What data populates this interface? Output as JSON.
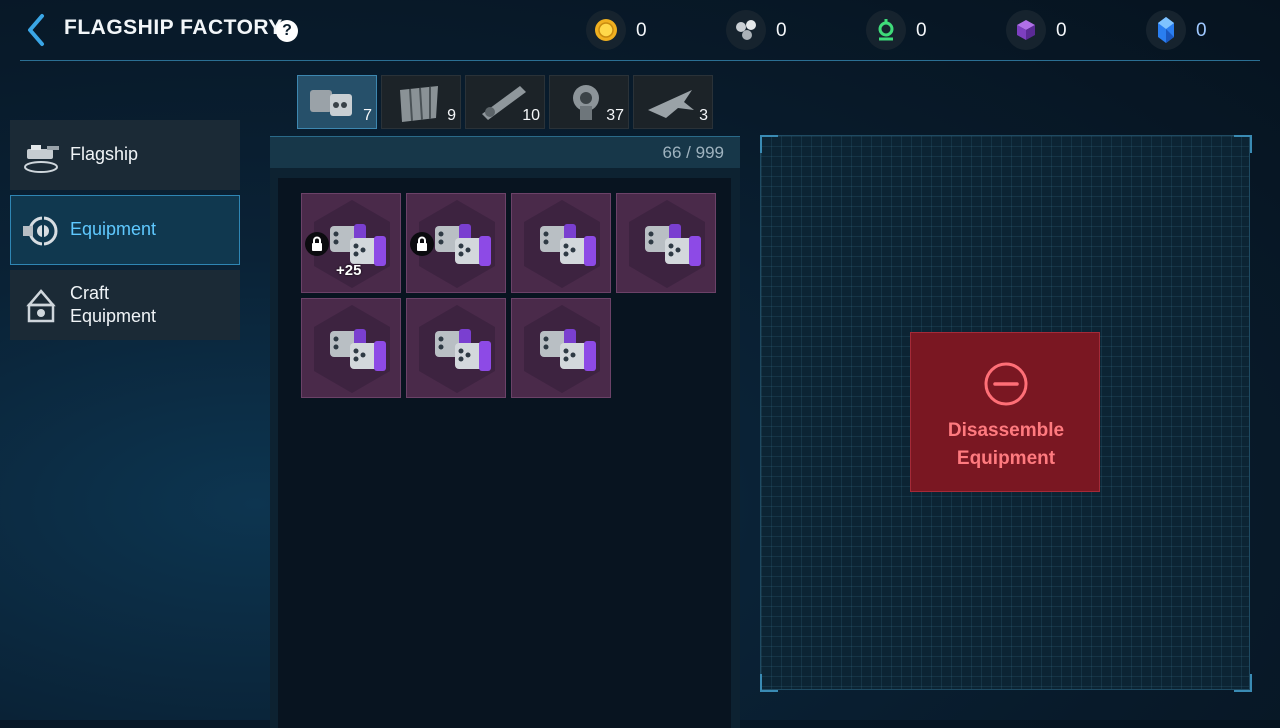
{
  "header": {
    "title": "FLAGSHIP FACTORY",
    "help_label": "?",
    "resources": [
      {
        "name": "gold-coin-icon",
        "value": "0"
      },
      {
        "name": "alloy-cluster-icon",
        "value": "0"
      },
      {
        "name": "green-crystal-node-icon",
        "value": "0"
      },
      {
        "name": "purple-cube-icon",
        "value": "0"
      },
      {
        "name": "blue-crystal-icon",
        "value": "0"
      }
    ]
  },
  "sidebar": {
    "items": [
      {
        "label": "Flagship",
        "icon": "flagship-icon",
        "active": false
      },
      {
        "label": "Equipment",
        "icon": "equipment-icon",
        "active": true
      },
      {
        "label_line1": "Craft",
        "label_line2": "Equipment",
        "icon": "craft-equipment-icon",
        "active": false
      }
    ]
  },
  "tabs": [
    {
      "icon": "missile-launcher-icon",
      "count": "7",
      "active": true
    },
    {
      "icon": "armor-plate-icon",
      "count": "9",
      "active": false
    },
    {
      "icon": "cannon-barrel-icon",
      "count": "10",
      "active": false
    },
    {
      "icon": "turret-module-icon",
      "count": "37",
      "active": false
    },
    {
      "icon": "aircraft-icon",
      "count": "3",
      "active": false
    }
  ],
  "inventory": {
    "capacity": "66 / 999",
    "slots": [
      {
        "locked": true,
        "bonus": "+25"
      },
      {
        "locked": true,
        "bonus": ""
      },
      {
        "locked": false,
        "bonus": ""
      },
      {
        "locked": false,
        "bonus": ""
      },
      {
        "locked": false,
        "bonus": ""
      },
      {
        "locked": false,
        "bonus": ""
      },
      {
        "locked": false,
        "bonus": ""
      }
    ]
  },
  "actions": {
    "disassemble_line1": "Disassemble",
    "disassemble_line2": "Equipment"
  },
  "colors": {
    "accent": "#5fc9ff",
    "danger": "#7a1722",
    "danger_text": "#ff7a7f",
    "slot_purple": "#4a2a4a"
  }
}
